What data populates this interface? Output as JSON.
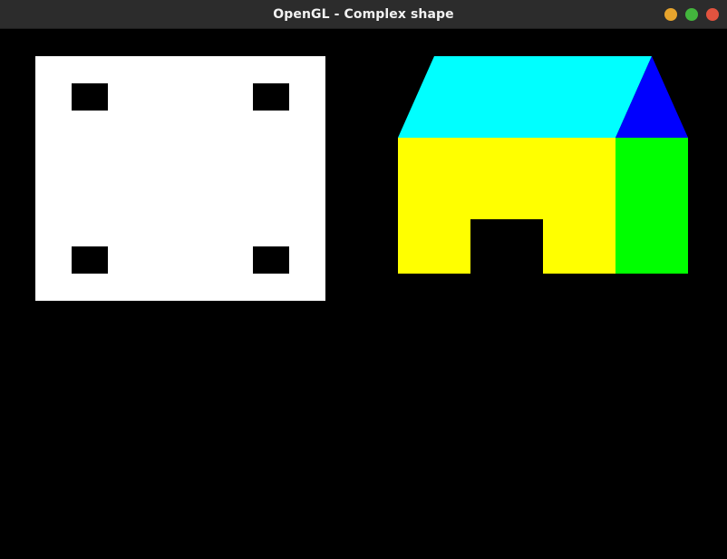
{
  "window": {
    "title": "OpenGL - Complex shape"
  },
  "controls": {
    "minimize_color": "#e6a42d",
    "maximize_color": "#43b53d",
    "close_color": "#e2533f"
  },
  "scene": {
    "background_color": "#000000",
    "panel_color": "#ffffff",
    "hole_color": "#000000",
    "roof_front_color": "#00ffff",
    "roof_side_color": "#0000ff",
    "wall_front_color": "#ffff00",
    "wall_side_color": "#00ff00",
    "door_color": "#000000"
  }
}
